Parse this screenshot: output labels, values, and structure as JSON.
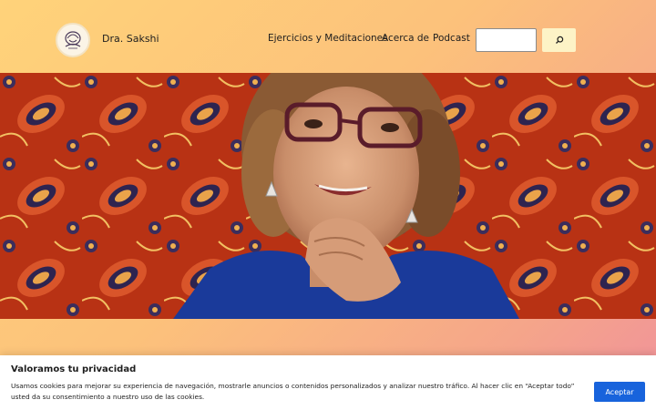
{
  "header": {
    "site_title": "Dra. Sakshi",
    "logo_icon": "lotus-head-icon"
  },
  "nav": {
    "items": [
      {
        "label": "Ejercicios y Meditaciones"
      },
      {
        "label": "Acerca de"
      },
      {
        "label": "Podcast"
      }
    ]
  },
  "search": {
    "value": "",
    "placeholder": "",
    "button_icon": "search-icon"
  },
  "hero": {
    "alt": "Foto de la Dra. Sakshi"
  },
  "cookie_banner": {
    "title": "Valoramos tu privacidad",
    "text": "Usamos cookies para mejorar su experiencia de navegación, mostrarle anuncios o contenidos personalizados y analizar nuestro tráfico. Al hacer clic en “Aceptar todo” usted da su consentimiento a nuestro uso de las cookies.",
    "accept_label": "Aceptar"
  },
  "colors": {
    "gradient_start": "#ffd37a",
    "gradient_end": "#f0919b",
    "accept_button": "#1863dc",
    "search_button": "#fdf3c6"
  }
}
